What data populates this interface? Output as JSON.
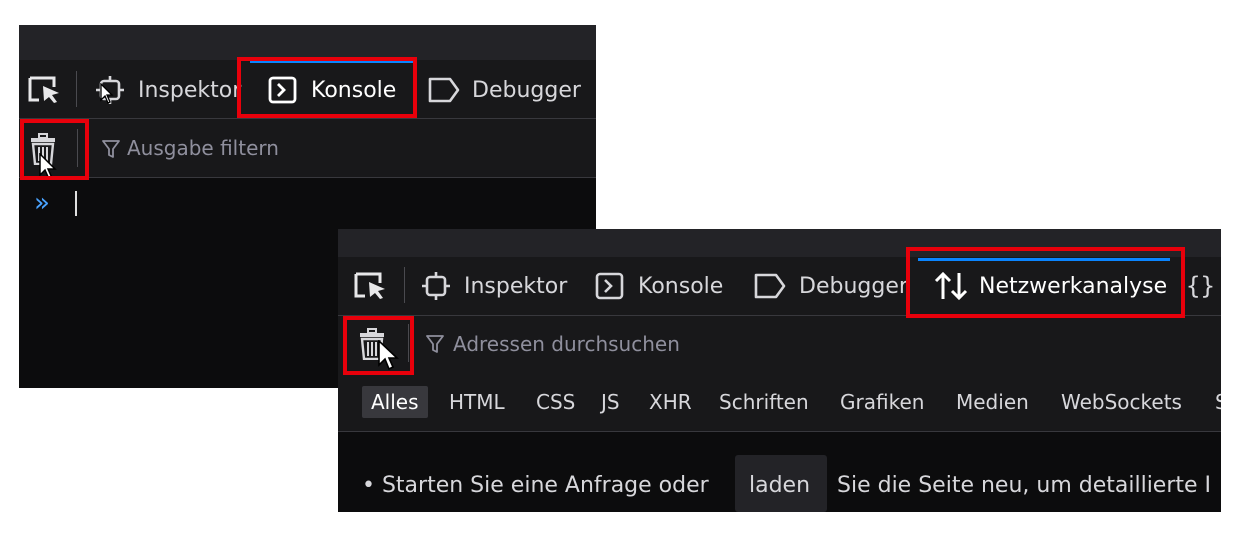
{
  "console_panel": {
    "tabs": [
      {
        "label": "Inspektor",
        "icon": "inspector-icon",
        "active": false
      },
      {
        "label": "Konsole",
        "icon": "console-icon",
        "active": true
      },
      {
        "label": "Debugger",
        "icon": "debugger-icon",
        "active": false
      }
    ],
    "filter_placeholder": "Ausgabe filtern",
    "prompt": "»"
  },
  "network_panel": {
    "tabs": [
      {
        "label": "Inspektor",
        "icon": "inspector-icon",
        "active": false
      },
      {
        "label": "Konsole",
        "icon": "console-icon",
        "active": false
      },
      {
        "label": "Debugger",
        "icon": "debugger-icon",
        "active": false
      },
      {
        "label": "Netzwerkanalyse",
        "icon": "network-arrows-icon",
        "active": true
      },
      {
        "label": "{}",
        "icon": "style-editor-icon",
        "active": false
      }
    ],
    "filter_placeholder": "Adressen durchsuchen",
    "types": [
      "Alles",
      "HTML",
      "CSS",
      "JS",
      "XHR",
      "Schriften",
      "Grafiken",
      "Medien",
      "WebSockets",
      "S"
    ],
    "message_before": "• Starten Sie eine Anfrage oder",
    "reload_label": "laden",
    "message_after": "Sie die Seite neu, um detaillierte I"
  },
  "colors": {
    "highlight": "#e8000b",
    "active_tab_line": "#0a84ff",
    "panel_bg": "#0c0c0d",
    "toolbar_bg": "#18181a"
  }
}
